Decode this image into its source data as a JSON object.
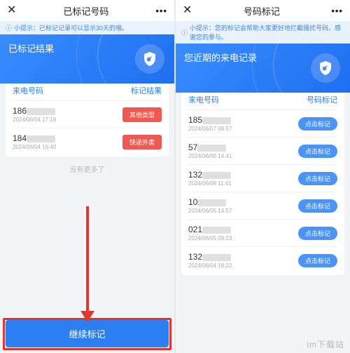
{
  "watermark": "im下载站",
  "left": {
    "nav": {
      "close": "✕",
      "title": "已标记号码",
      "more": "•••"
    },
    "tip": {
      "icon": "ⓘ",
      "text": "小提示：已标记记录可以显示30天的哦。"
    },
    "hero": {
      "title": "已标记结果"
    },
    "columns": {
      "col1": "来电号码",
      "col2": "标记结果"
    },
    "rows": [
      {
        "prefix": "186",
        "time": "2024/06/04 17:16",
        "tag": "其他类型"
      },
      {
        "prefix": "184",
        "time": "2024/06/04 16:40",
        "tag": "快递外卖"
      }
    ],
    "nomore": "没有更多了",
    "cta": "继续标记"
  },
  "right": {
    "nav": {
      "close": "✕",
      "title": "号码标记",
      "more": "•••"
    },
    "tip": {
      "icon": "ⓘ",
      "text": "小提示：您的标记会帮助大家更好地拦截骚扰号码，感谢您的参与。"
    },
    "hero": {
      "title": "您近期的来电记录"
    },
    "columns": {
      "col1": "来电号码",
      "col2": "号码标记"
    },
    "rows": [
      {
        "prefix": "185",
        "time": "2024/06/07 08:57",
        "btn": "点击标记"
      },
      {
        "prefix": "57",
        "time": "2024/06/06 14:41",
        "btn": "点击标记"
      },
      {
        "prefix": "132",
        "time": "2024/06/06 11:41",
        "btn": "点击标记"
      },
      {
        "prefix": "10",
        "time": "2024/06/05 14:57",
        "btn": "点击标记"
      },
      {
        "prefix": "021",
        "time": "2024/06/05 09:23",
        "btn": "点击标记"
      },
      {
        "prefix": "132",
        "time": "2024/06/04 18:22",
        "btn": "点击标记"
      }
    ]
  }
}
